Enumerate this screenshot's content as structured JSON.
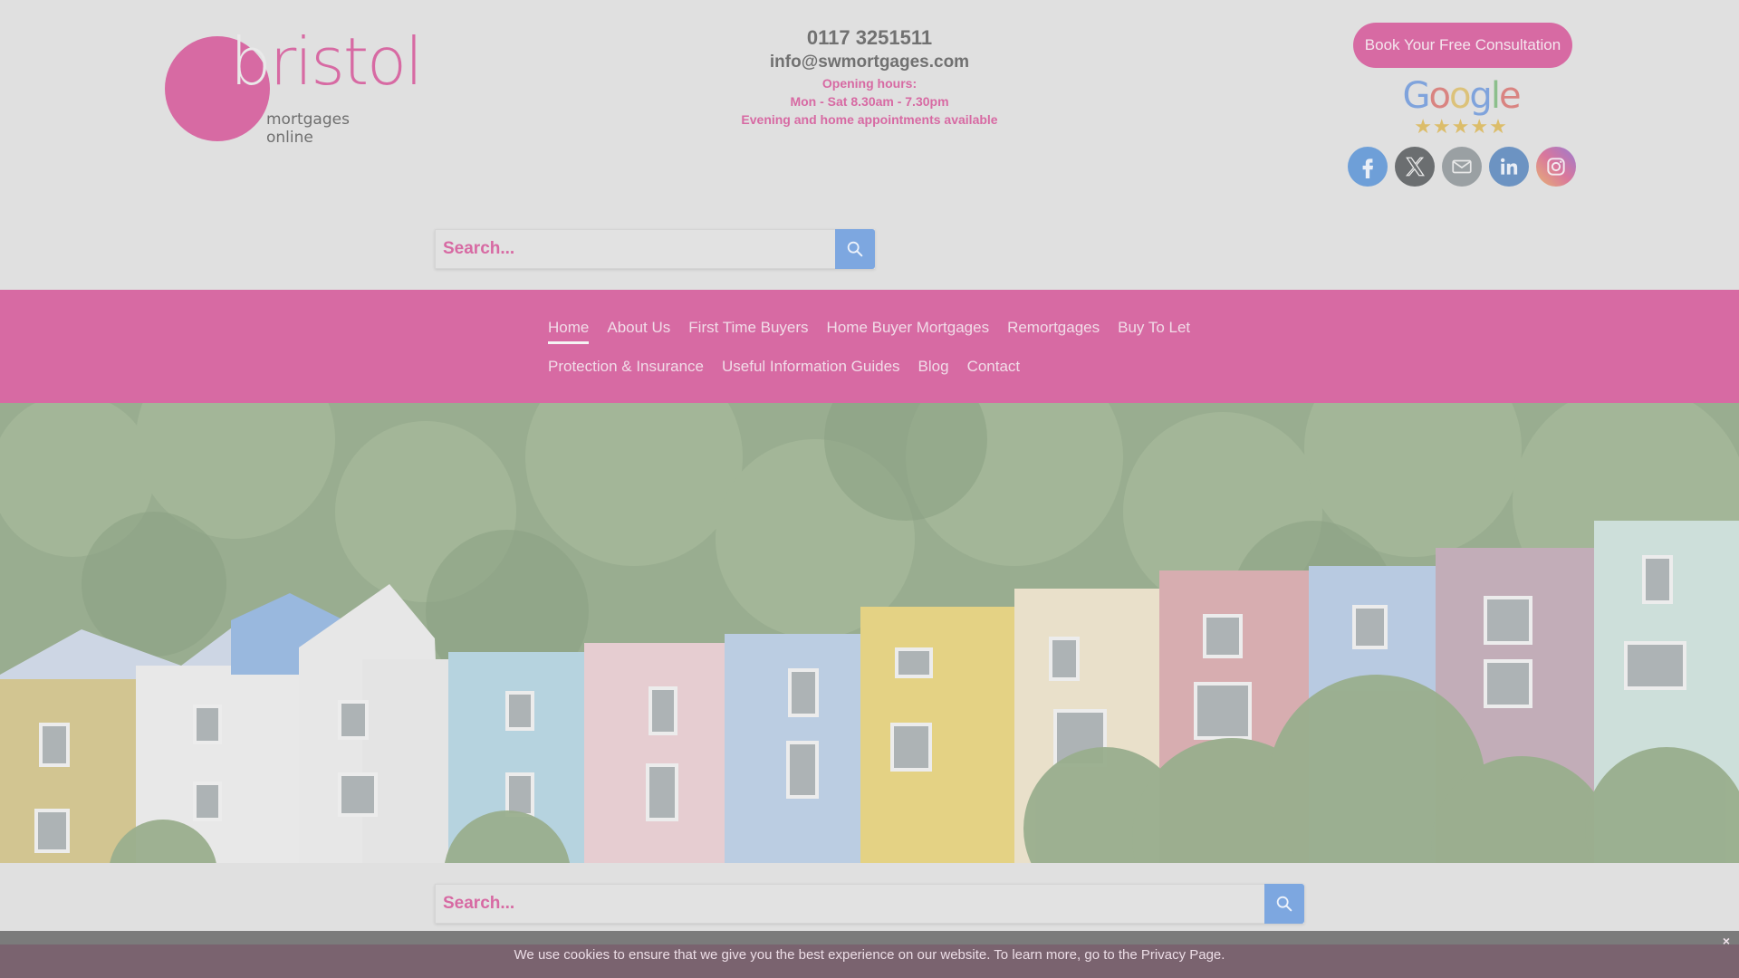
{
  "brand": {
    "logo_word": "bristol",
    "logo_first_letter": "b",
    "logo_rest": "ristol",
    "logo_subtitle": "mortgages online",
    "accent_color": "#d76aa3"
  },
  "contact": {
    "phone": "0117 3251511",
    "email": "info@swmortgages.com",
    "hours_label": "Opening hours:",
    "hours": "Mon - Sat 8.30am - 7.30pm",
    "note": "Evening and home appointments available"
  },
  "cta": {
    "label": "Book Your Free Consultation"
  },
  "reviews": {
    "provider": "Google",
    "rating_out_of_5": 5,
    "stars": "★★★★★"
  },
  "socials": [
    {
      "name": "facebook",
      "icon": "facebook-icon",
      "color": "#6e9fd8"
    },
    {
      "name": "x",
      "icon": "x-icon",
      "color": "#6b6e70"
    },
    {
      "name": "email",
      "icon": "mail-icon",
      "color": "#9aa0a3"
    },
    {
      "name": "linkedin",
      "icon": "linkedin-icon",
      "color": "#6c93c2"
    },
    {
      "name": "instagram",
      "icon": "instagram-icon",
      "color": "#d9779c"
    }
  ],
  "search_top": {
    "placeholder": "Search..."
  },
  "search_bottom": {
    "placeholder": "Search..."
  },
  "nav": {
    "row1": [
      {
        "label": "Home",
        "active": true
      },
      {
        "label": "About Us"
      },
      {
        "label": "First Time Buyers"
      },
      {
        "label": "Home Buyer Mortgages"
      },
      {
        "label": "Remortgages"
      },
      {
        "label": "Buy To Let"
      }
    ],
    "row2": [
      {
        "label": "Protection & Insurance"
      },
      {
        "label": "Useful Information Guides"
      },
      {
        "label": "Blog"
      },
      {
        "label": "Contact"
      }
    ]
  },
  "hero": {
    "alt": "Row of colourful terraced houses in front of wooded hillside"
  },
  "cookie": {
    "message": "We use cookies to ensure that we give you the best experience on our website. To learn more, go to the Privacy Page.",
    "close": "×"
  }
}
